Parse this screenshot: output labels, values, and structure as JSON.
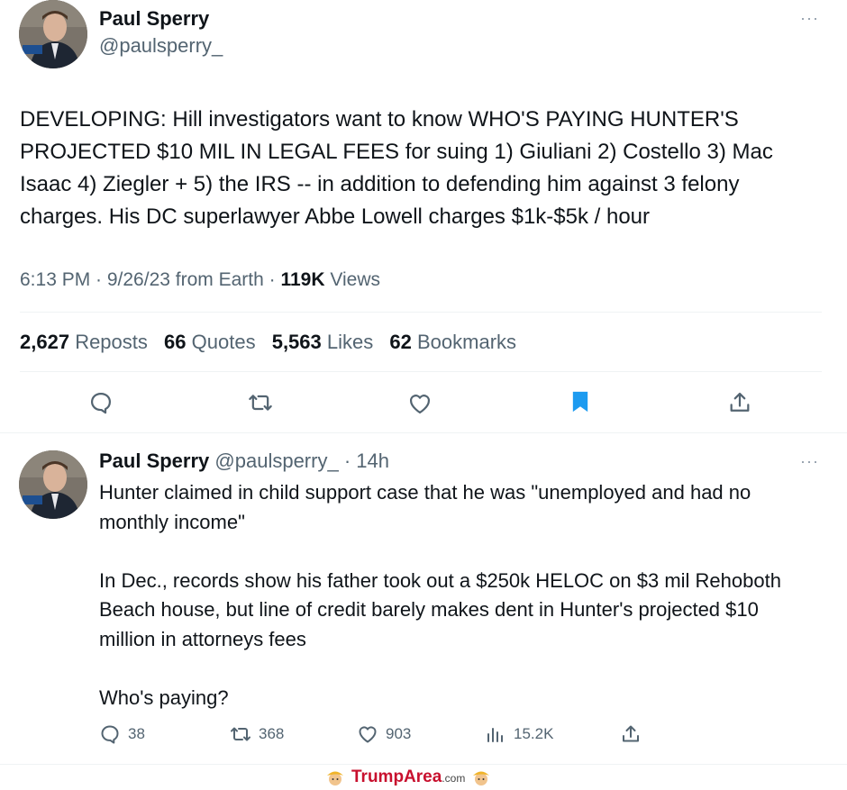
{
  "main_tweet": {
    "author_name": "Paul Sperry",
    "author_handle": "@paulsperry_",
    "more_icon": "more-dots-icon",
    "text": "DEVELOPING: Hill investigators want to know WHO'S PAYING HUNTER'S PROJECTED $10 MIL IN LEGAL FEES for suing 1) Giuliani 2) Costello 3) Mac Isaac 4) Ziegler + 5) the IRS -- in addition to defending him against 3 felony charges. His DC superlawyer Abbe Lowell charges $1k-$5k / hour",
    "timestamp": "6:13 PM · 9/26/23 from Earth ·",
    "views_count": "119K",
    "views_label": "Views",
    "stats": {
      "reposts_count": "2,627",
      "reposts_label": "Reposts",
      "quotes_count": "66",
      "quotes_label": "Quotes",
      "likes_count": "5,563",
      "likes_label": "Likes",
      "bookmarks_count": "62",
      "bookmarks_label": "Bookmarks"
    },
    "bookmark_color": "#1d9bf0"
  },
  "reply": {
    "author_name": "Paul Sperry",
    "author_handle": "@paulsperry_",
    "time": "· 14h",
    "text": "Hunter claimed in child support case that he was \"unemployed and had no monthly income\"\n\nIn Dec., records show his father took out a $250k HELOC on $3 mil Rehoboth Beach house, but line of credit barely makes dent in Hunter's projected $10 million in attorneys fees\n\nWho's paying?",
    "actions": {
      "replies": "38",
      "reposts": "368",
      "likes": "903",
      "views": "15.2K"
    }
  },
  "watermark": {
    "brand": "TrumpArea",
    "suffix": ".com"
  }
}
